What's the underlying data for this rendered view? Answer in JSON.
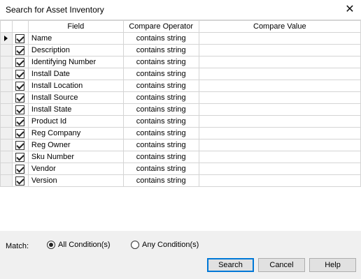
{
  "window": {
    "title": "Search for Asset Inventory",
    "close_glyph": "✕"
  },
  "grid": {
    "headers": {
      "field": "Field",
      "operator": "Compare Operator",
      "value": "Compare Value"
    },
    "rows": [
      {
        "checked": true,
        "field": "Name",
        "operator": "contains string",
        "value": "",
        "current": true
      },
      {
        "checked": true,
        "field": "Description",
        "operator": "contains string",
        "value": ""
      },
      {
        "checked": true,
        "field": "Identifying Number",
        "operator": "contains string",
        "value": ""
      },
      {
        "checked": true,
        "field": "Install Date",
        "operator": "contains string",
        "value": ""
      },
      {
        "checked": true,
        "field": "Install Location",
        "operator": "contains string",
        "value": ""
      },
      {
        "checked": true,
        "field": "Install Source",
        "operator": "contains string",
        "value": ""
      },
      {
        "checked": true,
        "field": "Install State",
        "operator": "contains string",
        "value": ""
      },
      {
        "checked": true,
        "field": "Product Id",
        "operator": "contains string",
        "value": ""
      },
      {
        "checked": true,
        "field": "Reg Company",
        "operator": "contains string",
        "value": ""
      },
      {
        "checked": true,
        "field": "Reg Owner",
        "operator": "contains string",
        "value": ""
      },
      {
        "checked": true,
        "field": "Sku Number",
        "operator": "contains string",
        "value": ""
      },
      {
        "checked": true,
        "field": "Vendor",
        "operator": "contains string",
        "value": ""
      },
      {
        "checked": true,
        "field": "Version",
        "operator": "contains string",
        "value": ""
      }
    ]
  },
  "match": {
    "label": "Match:",
    "options": [
      {
        "label": "All Condition(s)",
        "selected": true
      },
      {
        "label": "Any Condition(s)",
        "selected": false
      }
    ]
  },
  "buttons": {
    "search": "Search",
    "cancel": "Cancel",
    "help": "Help"
  },
  "colors": {
    "default_button_border": "#0078d7",
    "grid_line": "#d4d4d4",
    "dialog_bg": "#f0f0f0"
  }
}
